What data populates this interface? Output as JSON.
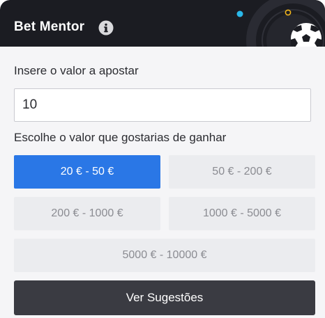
{
  "header": {
    "title": "Bet Mentor",
    "info_icon": "info-circle-icon",
    "decoration_icon": "soccer-ball-icon",
    "colors": {
      "background": "#1b1c22",
      "dot_blue": "#2ab8ea",
      "dot_yellow": "#f2b51c"
    }
  },
  "form": {
    "amount_label": "Insere o valor a apostar",
    "amount_value": "10",
    "win_label": "Escolhe o valor que gostarias de ganhar",
    "options": [
      {
        "label": "20 € - 50 €",
        "selected": true
      },
      {
        "label": "50 € - 200 €",
        "selected": false
      },
      {
        "label": "200 € - 1000 €",
        "selected": false
      },
      {
        "label": "1000 € - 5000 €",
        "selected": false
      },
      {
        "label": "5000 € - 10000 €",
        "selected": false
      }
    ],
    "submit_label": "Ver Sugestões"
  },
  "colors": {
    "accent": "#2a77e6",
    "option_bg": "#ebecef",
    "submit_bg": "#3a3b42"
  }
}
